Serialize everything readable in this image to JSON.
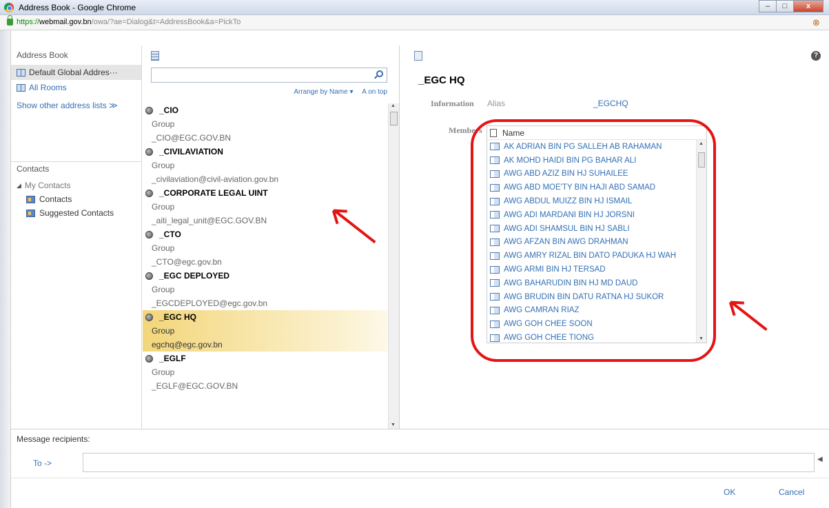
{
  "window": {
    "title": "Address Book - Google Chrome",
    "minimize": "–",
    "maximize": "□",
    "close": "x"
  },
  "urlbar": {
    "scheme": "https://",
    "host": "webmail.gov.bn",
    "path": "/owa/?ae=Dialog&t=AddressBook&a=PickTo"
  },
  "left": {
    "heading": "Address Book",
    "items": [
      {
        "label": "Default Global Addres···",
        "selected": true
      },
      {
        "label": "All Rooms"
      }
    ],
    "show_other": "Show other address lists ≫",
    "contacts_heading": "Contacts",
    "my_contacts": "My Contacts",
    "contact_folders": [
      "Contacts",
      "Suggested Contacts"
    ]
  },
  "middle": {
    "search_value": "",
    "arrange_by": "Arrange by Name",
    "order": "A on top",
    "entries": [
      {
        "name": "_CIO",
        "type": "Group",
        "email": "_CIO@EGC.GOV.BN"
      },
      {
        "name": "_CIVILAVIATION",
        "type": "Group",
        "email": "_civilaviation@civil-aviation.gov.bn"
      },
      {
        "name": "_CORPORATE LEGAL UINT",
        "type": "Group",
        "email": "_aiti_legal_unit@EGC.GOV.BN"
      },
      {
        "name": "_CTO",
        "type": "Group",
        "email": "_CTO@egc.gov.bn"
      },
      {
        "name": "_EGC DEPLOYED",
        "type": "Group",
        "email": "_EGCDEPLOYED@egc.gov.bn"
      },
      {
        "name": "_EGC HQ",
        "type": "Group",
        "email": "egchq@egc.gov.bn",
        "selected": true
      },
      {
        "name": "_EGLF",
        "type": "Group",
        "email": "_EGLF@EGC.GOV.BN"
      }
    ]
  },
  "detail": {
    "title": "_EGC HQ",
    "info_label": "Information",
    "alias_label": "Alias",
    "alias_value": "_EGCHQ",
    "members_label": "Members",
    "members_column": "Name",
    "members": [
      "AK ADRIAN BIN PG SALLEH AB RAHAMAN",
      "AK MOHD HAIDI BIN PG BAHAR ALI",
      "AWG ABD AZIZ BIN HJ SUHAILEE",
      "AWG ABD MOE'TY BIN HAJI ABD SAMAD",
      "AWG ABDUL MUIZZ BIN HJ ISMAIL",
      "AWG ADI MARDANI BIN HJ JORSNI",
      "AWG ADI SHAMSUL BIN HJ SABLI",
      "AWG AFZAN BIN AWG DRAHMAN",
      "AWG AMRY RIZAL BIN DATO PADUKA HJ WAH",
      "AWG ARMI BIN HJ TERSAD",
      "AWG BAHARUDIN BIN HJ MD DAUD",
      "AWG BRUDIN BIN DATU RATNA HJ SUKOR",
      "AWG CAMRAN RIAZ",
      "AWG GOH CHEE SOON",
      "AWG GOH CHEE TIONG"
    ]
  },
  "recipients": {
    "label": "Message recipients:",
    "to_link": "To ->",
    "to_value": ""
  },
  "buttons": {
    "ok": "OK",
    "cancel": "Cancel"
  },
  "colors": {
    "link": "#336fb5",
    "annotation": "#e41414",
    "selected_row": "#f3d67a"
  }
}
